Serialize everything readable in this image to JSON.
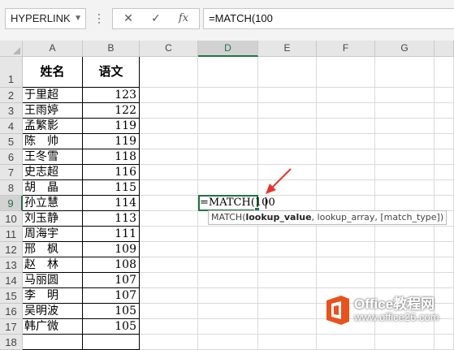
{
  "formula_bar": {
    "name_box": "HYPERLINK",
    "cancel_symbol": "✕",
    "enter_symbol": "✓",
    "fx_label": "fx",
    "formula": "=MATCH(100"
  },
  "columns": [
    "A",
    "B",
    "C",
    "D",
    "E",
    "F",
    "G"
  ],
  "rows": [
    "1",
    "2",
    "3",
    "4",
    "5",
    "6",
    "7",
    "8",
    "9",
    "10",
    "11",
    "12",
    "13",
    "14",
    "15",
    "16",
    "17",
    "18"
  ],
  "headers": {
    "name": "姓名",
    "score": "语文"
  },
  "students": [
    {
      "name": "于里超",
      "score": "123"
    },
    {
      "name": "王雨婷",
      "score": "122"
    },
    {
      "name": "孟繁影",
      "score": "119"
    },
    {
      "name": "陈　帅",
      "score": "119"
    },
    {
      "name": "王冬雪",
      "score": "118"
    },
    {
      "name": "史志超",
      "score": "116"
    },
    {
      "name": "胡　晶",
      "score": "115"
    },
    {
      "name": "孙立慧",
      "score": "114"
    },
    {
      "name": "刘玉静",
      "score": "113"
    },
    {
      "name": "周海宇",
      "score": "111"
    },
    {
      "name": "邢　枫",
      "score": "109"
    },
    {
      "name": "赵　林",
      "score": "108"
    },
    {
      "name": "马丽圆",
      "score": "107"
    },
    {
      "name": "李　明",
      "score": "107"
    },
    {
      "name": "吴明波",
      "score": "105"
    },
    {
      "name": "韩广微",
      "score": "105"
    }
  ],
  "active_cell": {
    "ref": "D9",
    "text": "=MATCH(100"
  },
  "tooltip": {
    "func": "MATCH(",
    "arg1": "lookup_value",
    "rest": ", lookup_array, [match_type])"
  },
  "watermark": {
    "title": "Office教程网",
    "url": "www.office26.com"
  },
  "colors": {
    "excel_green": "#217346",
    "arrow_red": "#e8352c",
    "logo_orange": "#e8521e"
  }
}
